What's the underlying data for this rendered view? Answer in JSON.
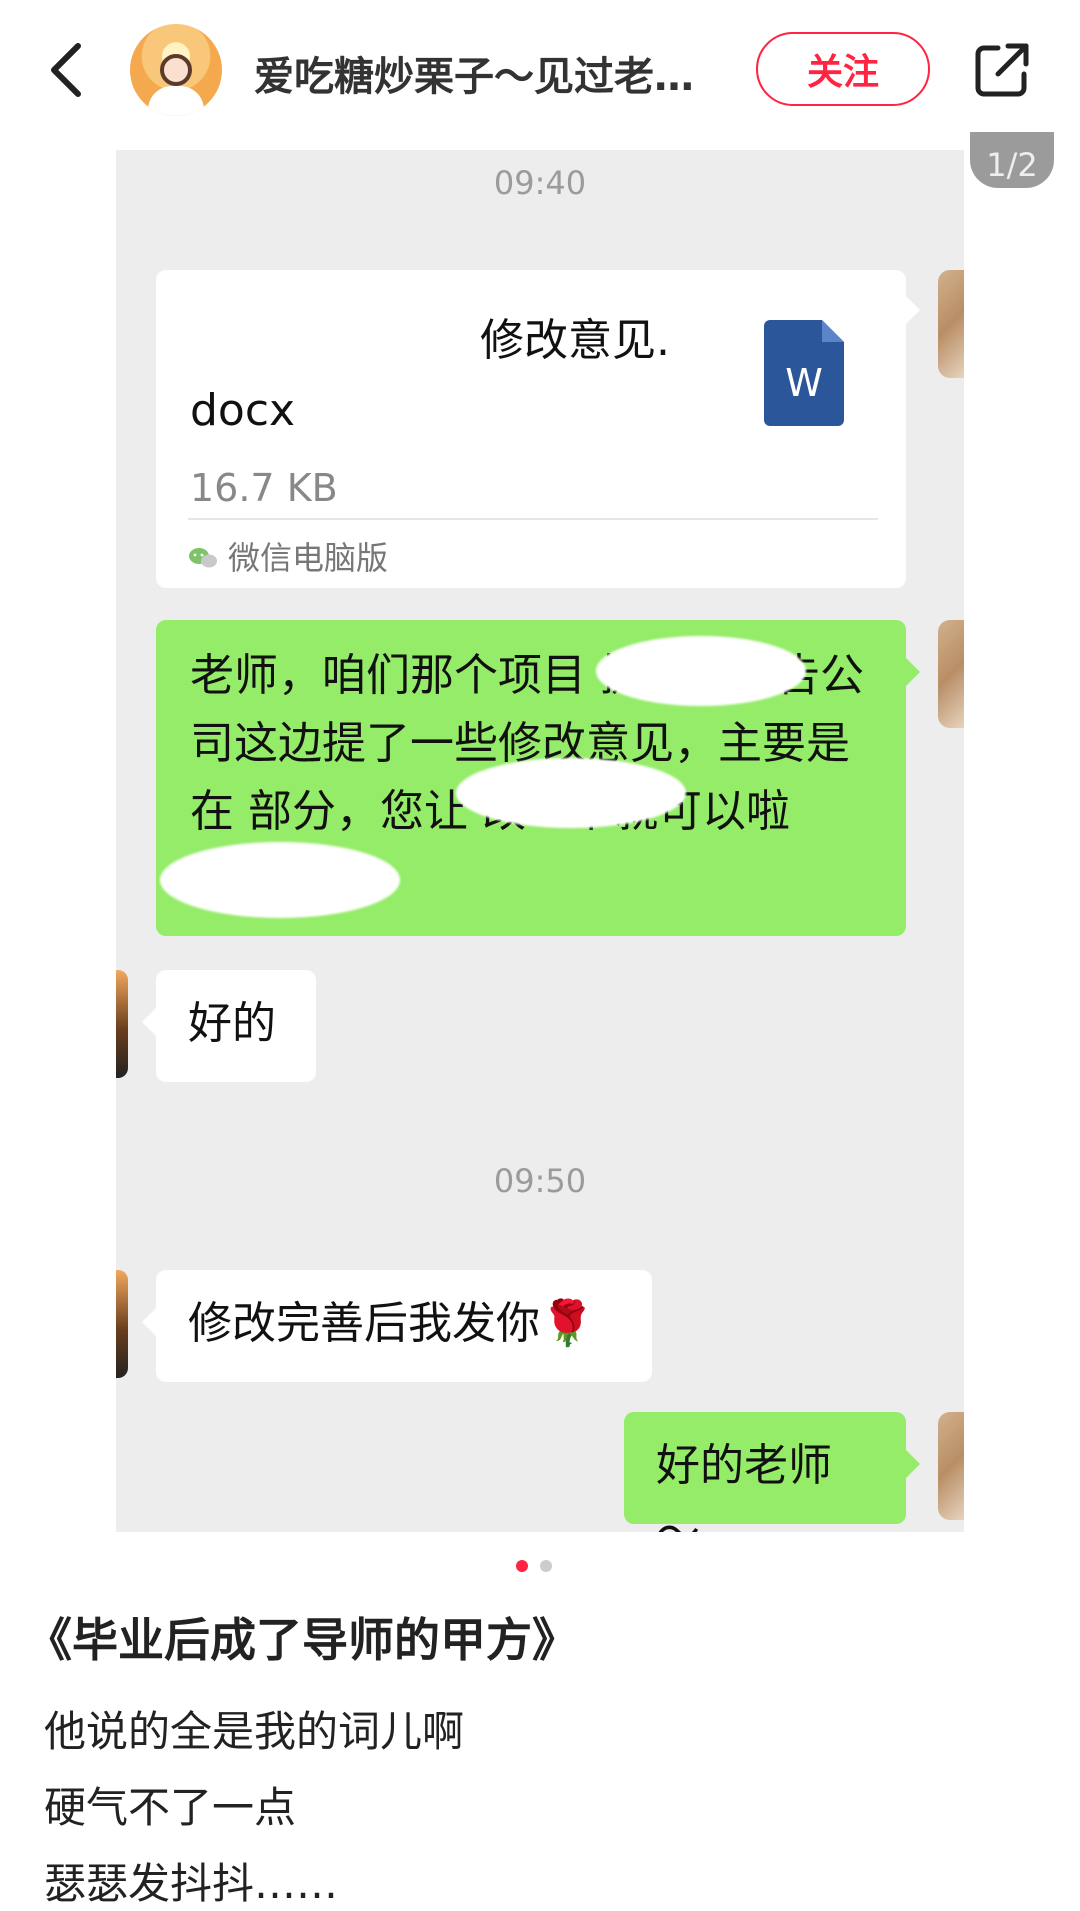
{
  "header": {
    "title": "爱吃糖炒栗子～见过老…",
    "follow_label": "关注",
    "back_icon": "chevron-left-icon",
    "share_icon": "share-icon"
  },
  "gallery": {
    "page_indicator": "1/2",
    "active_dot": 0,
    "dot_count": 2
  },
  "chat": {
    "time1": "09:40",
    "file": {
      "name_visible": "修改意见.",
      "name_line2": "docx",
      "size": "16.7 KB",
      "source": "微信电脑版",
      "doc_letter": "W"
    },
    "msg_long": "老师，咱们那个项目    提交的报告公司这边提了一些修改意见，主要是在    部分，您让    改一下就可以啦",
    "reply1": "好的",
    "time2": "09:50",
    "msg2": "修改完善后我发你🌹",
    "reply2": "好的老师～"
  },
  "post": {
    "title": "《毕业后成了导师的甲方》",
    "lines": [
      "他说的全是我的词儿啊",
      "硬气不了一点",
      "瑟瑟发抖抖……"
    ]
  },
  "colors": {
    "accent": "#ff2442",
    "wechat_green": "#95ec69",
    "chat_bg": "#ededed",
    "word_blue": "#2b579a"
  }
}
